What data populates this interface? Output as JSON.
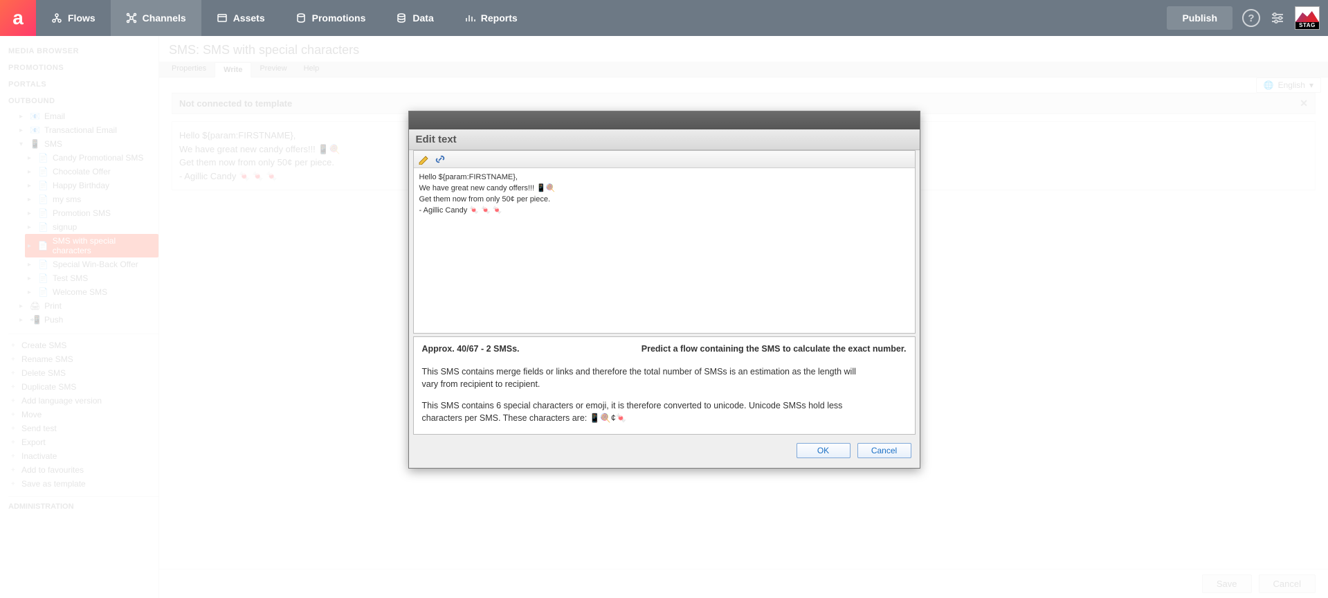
{
  "nav": {
    "items": [
      {
        "label": "Flows"
      },
      {
        "label": "Channels"
      },
      {
        "label": "Assets"
      },
      {
        "label": "Promotions"
      },
      {
        "label": "Data"
      },
      {
        "label": "Reports"
      }
    ],
    "publish": "Publish",
    "stag": "STAG"
  },
  "language_selector": "English",
  "sidebar": {
    "sections": {
      "media_browser": "MEDIA BROWSER",
      "promotions": "PROMOTIONS",
      "portals": "PORTALS",
      "outbound": "OUTBOUND",
      "administration": "ADMINISTRATION"
    },
    "tree": [
      {
        "label": "Email"
      },
      {
        "label": "Transactional Email"
      },
      {
        "label": "SMS",
        "children": [
          {
            "label": "Candy Promotional SMS"
          },
          {
            "label": "Chocolate Offer"
          },
          {
            "label": "Happy Birthday"
          },
          {
            "label": "my sms"
          },
          {
            "label": "Promotion SMS"
          },
          {
            "label": "signup"
          },
          {
            "label": "SMS with special characters"
          },
          {
            "label": "Special Win-Back Offer"
          },
          {
            "label": "Test SMS"
          },
          {
            "label": "Welcome SMS"
          }
        ]
      },
      {
        "label": "Print"
      },
      {
        "label": "Push"
      }
    ],
    "actions": [
      "Create SMS",
      "Rename SMS",
      "Delete SMS",
      "Duplicate SMS",
      "Add language version",
      "Move",
      "Send test",
      "Export",
      "Inactivate",
      "Add to favourites",
      "Save as template"
    ]
  },
  "main": {
    "breadcrumb": "SMS: SMS with special characters",
    "tabs": [
      {
        "label": "Properties"
      },
      {
        "label": "Write"
      },
      {
        "label": "Preview"
      },
      {
        "label": "Help"
      }
    ],
    "banner": "Not connected to template",
    "preview_lines": [
      "Hello ${param:FIRSTNAME},",
      "We have great new candy offers!!! 📱🍭",
      "Get them now from only 50¢ per piece.",
      "- Agillic Candy 🍬 🍬 🍬"
    ],
    "save": "Save",
    "cancel": "Cancel"
  },
  "dialog": {
    "title": "Edit text",
    "body_lines": [
      "Hello ${param:FIRSTNAME},",
      "We have great new candy offers!!! 📱🍭",
      "Get them now from only 50¢ per piece.",
      "- Agillic Candy 🍬 🍬 🍬"
    ],
    "count_text": "Approx. 40/67 - 2 SMSs.",
    "predict_text": "Predict a flow containing the SMS to calculate the exact number.",
    "merge_note": "This SMS contains merge fields or links and therefore the total number of SMSs is an estimation as the length will vary from recipient to recipient.",
    "unicode_note": "This SMS contains 6 special characters or emoji, it is therefore converted to unicode. Unicode SMSs hold less characters per SMS. These characters are: 📱🍭¢🍬",
    "ok": "OK",
    "cancel": "Cancel"
  }
}
